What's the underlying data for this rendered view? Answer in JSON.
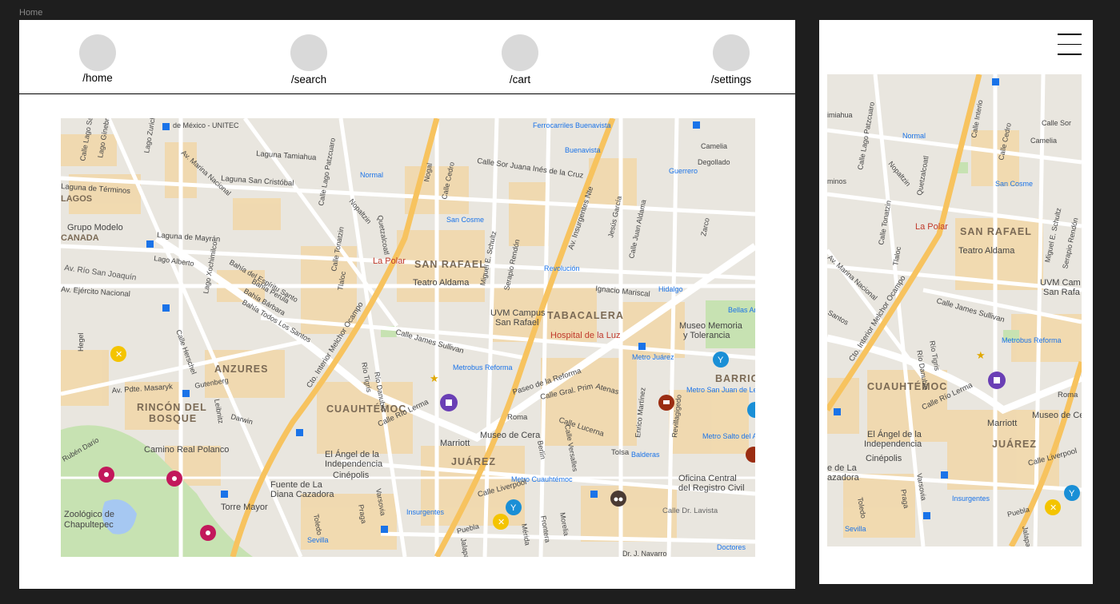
{
  "canvas": {
    "frame_label": "Home"
  },
  "nav": {
    "items": [
      {
        "label": "/home"
      },
      {
        "label": "/search"
      },
      {
        "label": "/cart"
      },
      {
        "label": "/settings"
      }
    ]
  },
  "map_desktop": {
    "labels": [
      "SAN RAFAEL",
      "TABACALERA",
      "ANZURES",
      "RINCÓN DEL",
      "BOSQUE",
      "CUAUHTÉMOC",
      "JUÁREZ",
      "BARRIO",
      "LAGOS",
      "CANADA",
      "Grupo Modelo",
      "Teatro Aldama",
      "UVM Campus",
      "San Rafael",
      "Hospital de la Luz",
      "Museo Memoria",
      "y Tolerancia",
      "Metrobus Reforma",
      "Marriott",
      "Museo de Cera",
      "El Ángel de la",
      "Independencia",
      "Cinépolis",
      "Fuente de La",
      "Diana Cazadora",
      "Torre Mayor",
      "Camino Real Polanco",
      "Zoológico de",
      "Chapultepec",
      "Oficina Central",
      "del Registro Civil",
      "Calle Dr. Lavista",
      "Metro Cuauhtémoc",
      "Insurgentes",
      "Sevilla",
      "Doctores",
      "Metro Juárez",
      "Metro San Juan de Letrán",
      "Metro Salto del Agua",
      "Balderas",
      "Hidalgo",
      "Bellas Artes",
      "Revolución",
      "San Cosme",
      "Normal",
      "Buenavista",
      "Guerrero",
      "Ferrocarriles Buenavista",
      "La Polar",
      "Cto. Interior Melchor Ocampo",
      "Av. Insurgentes Nte",
      "Paseo de la Reforma",
      "Calle Río Lerma",
      "Calle Liverpool",
      "Calle Lucerna",
      "Calle Gral. Prim",
      "Atenas",
      "Roma",
      "Tolsa",
      "Av. Río San Joaquín",
      "Av. Ejército Nacional",
      "Av. Pdte. Masaryk",
      "Laguna de Términos",
      "Laguna de Mayrán",
      "Laguna Tamiahua",
      "Laguna San Cristóbal",
      "Calle James Sullivan",
      "Ignacio Mariscal",
      "Calle Sor Juana Inés de la Cruz",
      "Calle Herschel",
      "Gutenberg",
      "Darwin",
      "Leibnitz",
      "Rubén Darío",
      "Hegel",
      "Lago Alberto",
      "Calle Lago Patzcuaro",
      "Nopaltzin",
      "Quetzalcoatl",
      "Nogal",
      "Calle Cedro",
      "Miguel E. Schultz",
      "Serapio Rendón",
      "Jesús García",
      "Calle Juan Aldama",
      "Zarco",
      "Camelia",
      "Degollado",
      "Calle Tonatzin",
      "Tlaloc",
      "Río Tigris",
      "Río Danubio",
      "Calle Versalles",
      "Berlín",
      "Enrico Martínez",
      "Revillagigedo",
      "Dr. J. Navarro",
      "Puebla",
      "Mérida",
      "Frontera",
      "Morelia",
      "Jalapa",
      "Praga",
      "Varsovia",
      "Toledo",
      "Bahía del Espíritu Santo",
      "Bahía Perula",
      "Bahía Bárbara",
      "Bahía Todos Los Santos",
      "Av. Marina Nacional",
      "Lago Xochimilco",
      "de México - UNITEC",
      "Lago Zurich",
      "Calle Lago San Juan",
      "Lago Gínebra"
    ]
  },
  "map_mobile": {
    "labels": [
      "SAN RAFAEL",
      "CUAUHTÉMOC",
      "JUÁREZ",
      "Teatro Aldama",
      "UVM Cam",
      "San Rafa",
      "La Polar",
      "Normal",
      "San Cosme",
      "Metrobus Reforma",
      "Marriott",
      "Museo de Ce",
      "El Ángel de la",
      "Independencia",
      "Cinépolis",
      "e de La",
      "azadora",
      "Insurgentes",
      "Sevilla",
      "Cto. Interior Melchor Ocampo",
      "Calle James Sullivan",
      "Calle Río Lerma",
      "Calle Liverpool",
      "Puebla",
      "Roma",
      "Calle Lago Patzcuaro",
      "Nopaltzin",
      "Quetzalcoatl",
      "Calle Cedro",
      "Camelia",
      "Calle Sor",
      "Miguel E. Schultz",
      "Serapio Rendón",
      "Río Tigris",
      "Río Danubio",
      "Tlaloc",
      "Calle Tonatzin",
      "Av. Marina Nacional",
      "Santos",
      "minos",
      "imiahua",
      "Praga",
      "Varsovia",
      "Toledo",
      "Jalapa",
      "Calle Interio"
    ]
  },
  "colors": {
    "canvas": "#1e1e1e",
    "frame": "#ffffff",
    "nav_circle": "#d9d9d9",
    "map_bg": "#e9e6df",
    "map_block": "#f2d7a8",
    "map_park": "#c7e2b2",
    "map_water": "#a6c8f2",
    "map_major_road": "#f7c35f",
    "metro": "#1a73e8"
  },
  "icons": {
    "hamburger": "menu-icon",
    "pin_food": "fork-knife-icon",
    "pin_bar": "cocktail-icon",
    "pin_shop": "shopping-bag-icon",
    "pin_museum": "palette-icon",
    "pin_cart": "cart-icon",
    "pin_binoculars": "binoculars-icon",
    "star": "star-icon"
  }
}
